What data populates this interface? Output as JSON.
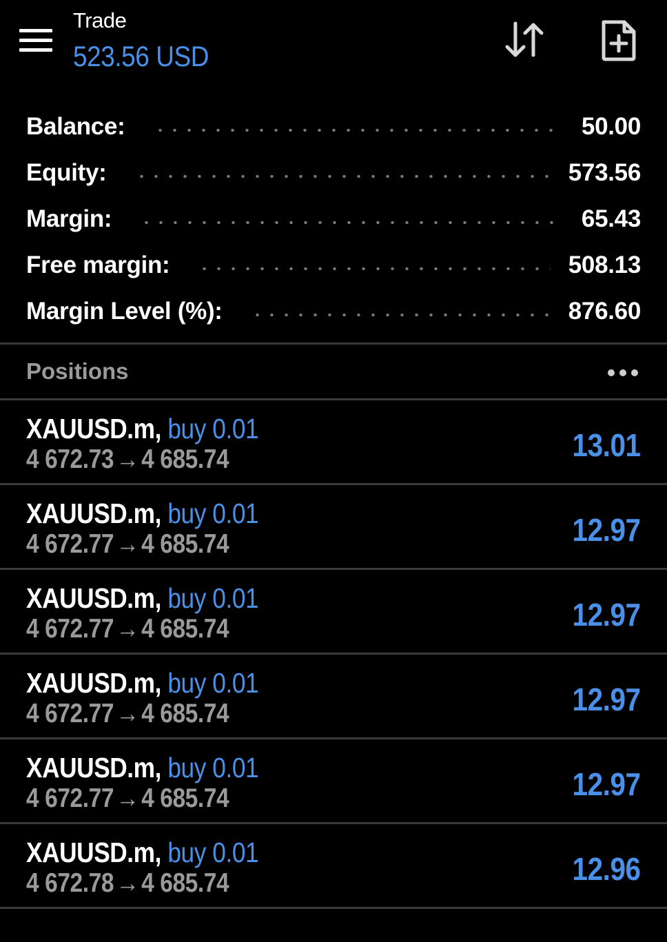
{
  "header": {
    "title": "Trade",
    "subtitle": "523.56 USD",
    "icons": [
      "menu-icon",
      "sort-icon",
      "add-document-icon"
    ]
  },
  "summary": [
    {
      "label": "Balance:",
      "value": "50.00"
    },
    {
      "label": "Equity:",
      "value": "573.56"
    },
    {
      "label": "Margin:",
      "value": "65.43"
    },
    {
      "label": "Free margin:",
      "value": "508.13"
    },
    {
      "label": "Margin Level (%):",
      "value": "876.60"
    }
  ],
  "positions": {
    "title": "Positions",
    "items": [
      {
        "symbol": "XAUUSD.m,",
        "side": "buy 0.01",
        "open": "4 672.73",
        "arrow": "→",
        "current": "4 685.74",
        "profit": "13.01"
      },
      {
        "symbol": "XAUUSD.m,",
        "side": "buy 0.01",
        "open": "4 672.77",
        "arrow": "→",
        "current": "4 685.74",
        "profit": "12.97"
      },
      {
        "symbol": "XAUUSD.m,",
        "side": "buy 0.01",
        "open": "4 672.77",
        "arrow": "→",
        "current": "4 685.74",
        "profit": "12.97"
      },
      {
        "symbol": "XAUUSD.m,",
        "side": "buy 0.01",
        "open": "4 672.77",
        "arrow": "→",
        "current": "4 685.74",
        "profit": "12.97"
      },
      {
        "symbol": "XAUUSD.m,",
        "side": "buy 0.01",
        "open": "4 672.77",
        "arrow": "→",
        "current": "4 685.74",
        "profit": "12.97"
      },
      {
        "symbol": "XAUUSD.m,",
        "side": "buy 0.01",
        "open": "4 672.78",
        "arrow": "→",
        "current": "4 685.74",
        "profit": "12.96"
      }
    ]
  },
  "colors": {
    "background": "#000000",
    "accent": "#4a90e8",
    "muted": "#9a9a9a",
    "divider": "#3a3a3a"
  }
}
